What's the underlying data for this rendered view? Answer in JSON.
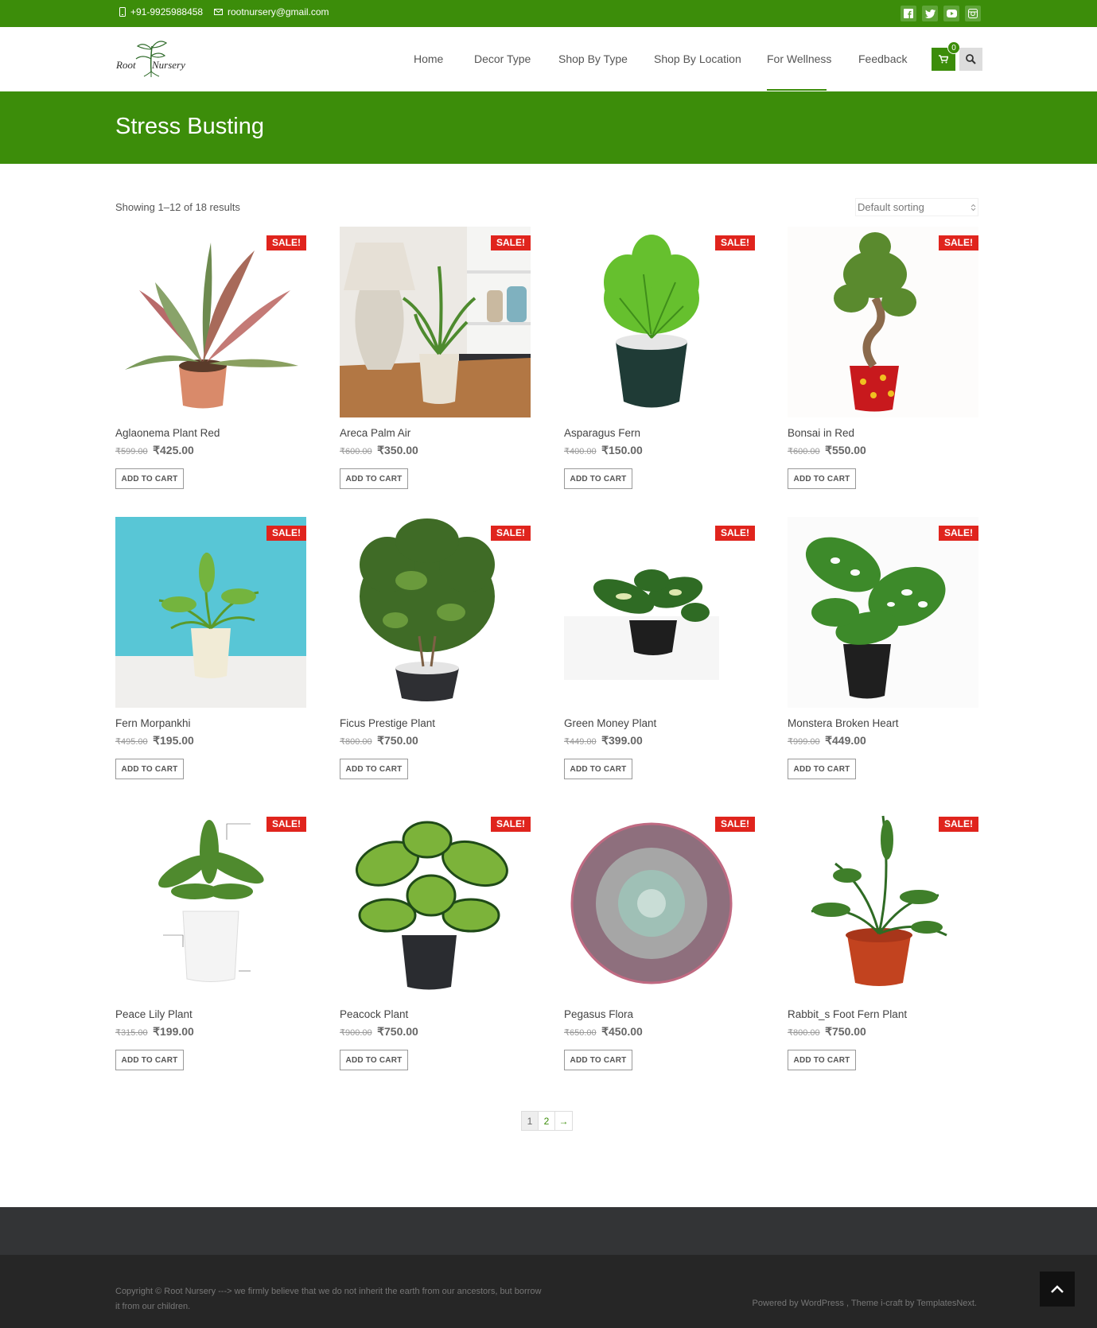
{
  "topbar": {
    "phone": "+91-9925988458",
    "email": "rootnursery@gmail.com",
    "social": [
      "facebook-icon",
      "twitter-icon",
      "youtube-icon",
      "instagram-icon"
    ],
    "color": "#3c8d0a"
  },
  "header": {
    "logo_text": "Root Nursery",
    "nav": [
      "Home",
      "Decor Type",
      "Shop By Type",
      "Shop By Location",
      "For Wellness",
      "Feedback"
    ],
    "active": "For Wellness",
    "cart_count": "0"
  },
  "banner": {
    "title": "Stress Busting"
  },
  "shop": {
    "results": "Showing 1–12 of 18 results",
    "sort": "Default sorting",
    "sale_label": "SALE!",
    "button_label": "ADD TO CART"
  },
  "products": [
    {
      "name": "Aglaonema Plant Red",
      "old": "₹599.00",
      "new": "₹425.00"
    },
    {
      "name": "Areca Palm Air",
      "old": "₹600.00",
      "new": "₹350.00"
    },
    {
      "name": "Asparagus Fern",
      "old": "₹400.00",
      "new": "₹150.00"
    },
    {
      "name": "Bonsai in Red",
      "old": "₹600.00",
      "new": "₹550.00"
    },
    {
      "name": "Fern Morpankhi",
      "old": "₹495.00",
      "new": "₹195.00"
    },
    {
      "name": "Ficus Prestige Plant",
      "old": "₹800.00",
      "new": "₹750.00"
    },
    {
      "name": "Green Money Plant",
      "old": "₹449.00",
      "new": "₹399.00"
    },
    {
      "name": "Monstera Broken Heart",
      "old": "₹999.00",
      "new": "₹449.00"
    },
    {
      "name": "Peace Lily Plant",
      "old": "₹315.00",
      "new": "₹199.00"
    },
    {
      "name": "Peacock Plant",
      "old": "₹900.00",
      "new": "₹750.00"
    },
    {
      "name": "Pegasus Flora",
      "old": "₹650.00",
      "new": "₹450.00"
    },
    {
      "name": "Rabbit_s Foot Fern Plant",
      "old": "₹800.00",
      "new": "₹750.00"
    }
  ],
  "pagination": {
    "current": "1",
    "next_page": "2",
    "arrow": "→"
  },
  "footer": {
    "copyright": "Copyright © Root Nursery ---> we firmly believe that we do not inherit the earth from our ancestors, but borrow it from our children.",
    "powered": "Powered by WordPress , Theme i-craft by TemplatesNext."
  }
}
